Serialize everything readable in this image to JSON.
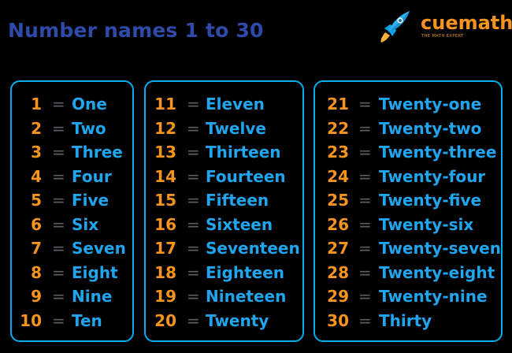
{
  "title": "Number names 1 to 30",
  "logo": {
    "wordmark": "cuemath",
    "tagline": "THE MATH EXPERT",
    "icon": "rocket-icon"
  },
  "colors": {
    "title": "#2f4aa8",
    "numbers": "#f7941d",
    "words": "#1fa6ee",
    "equals": "#5a5f66",
    "border": "#00aeef",
    "background": "#000000"
  },
  "equals_sign": "=",
  "columns": [
    {
      "rows": [
        {
          "number": "1",
          "name": "One"
        },
        {
          "number": "2",
          "name": "Two"
        },
        {
          "number": "3",
          "name": "Three"
        },
        {
          "number": "4",
          "name": "Four"
        },
        {
          "number": "5",
          "name": "Five"
        },
        {
          "number": "6",
          "name": "Six"
        },
        {
          "number": "7",
          "name": "Seven"
        },
        {
          "number": "8",
          "name": "Eight"
        },
        {
          "number": "9",
          "name": "Nine"
        },
        {
          "number": "10",
          "name": "Ten"
        }
      ]
    },
    {
      "rows": [
        {
          "number": "11",
          "name": "Eleven"
        },
        {
          "number": "12",
          "name": "Twelve"
        },
        {
          "number": "13",
          "name": "Thirteen"
        },
        {
          "number": "14",
          "name": "Fourteen"
        },
        {
          "number": "15",
          "name": "Fifteen"
        },
        {
          "number": "16",
          "name": "Sixteen"
        },
        {
          "number": "17",
          "name": "Seventeen"
        },
        {
          "number": "18",
          "name": "Eighteen"
        },
        {
          "number": "19",
          "name": "Nineteen"
        },
        {
          "number": "20",
          "name": "Twenty"
        }
      ]
    },
    {
      "rows": [
        {
          "number": "21",
          "name": "Twenty-one"
        },
        {
          "number": "22",
          "name": "Twenty-two"
        },
        {
          "number": "23",
          "name": "Twenty-three"
        },
        {
          "number": "24",
          "name": "Twenty-four"
        },
        {
          "number": "25",
          "name": "Twenty-five"
        },
        {
          "number": "26",
          "name": "Twenty-six"
        },
        {
          "number": "27",
          "name": "Twenty-seven"
        },
        {
          "number": "28",
          "name": "Twenty-eight"
        },
        {
          "number": "29",
          "name": "Twenty-nine"
        },
        {
          "number": "30",
          "name": "Thirty"
        }
      ]
    }
  ]
}
